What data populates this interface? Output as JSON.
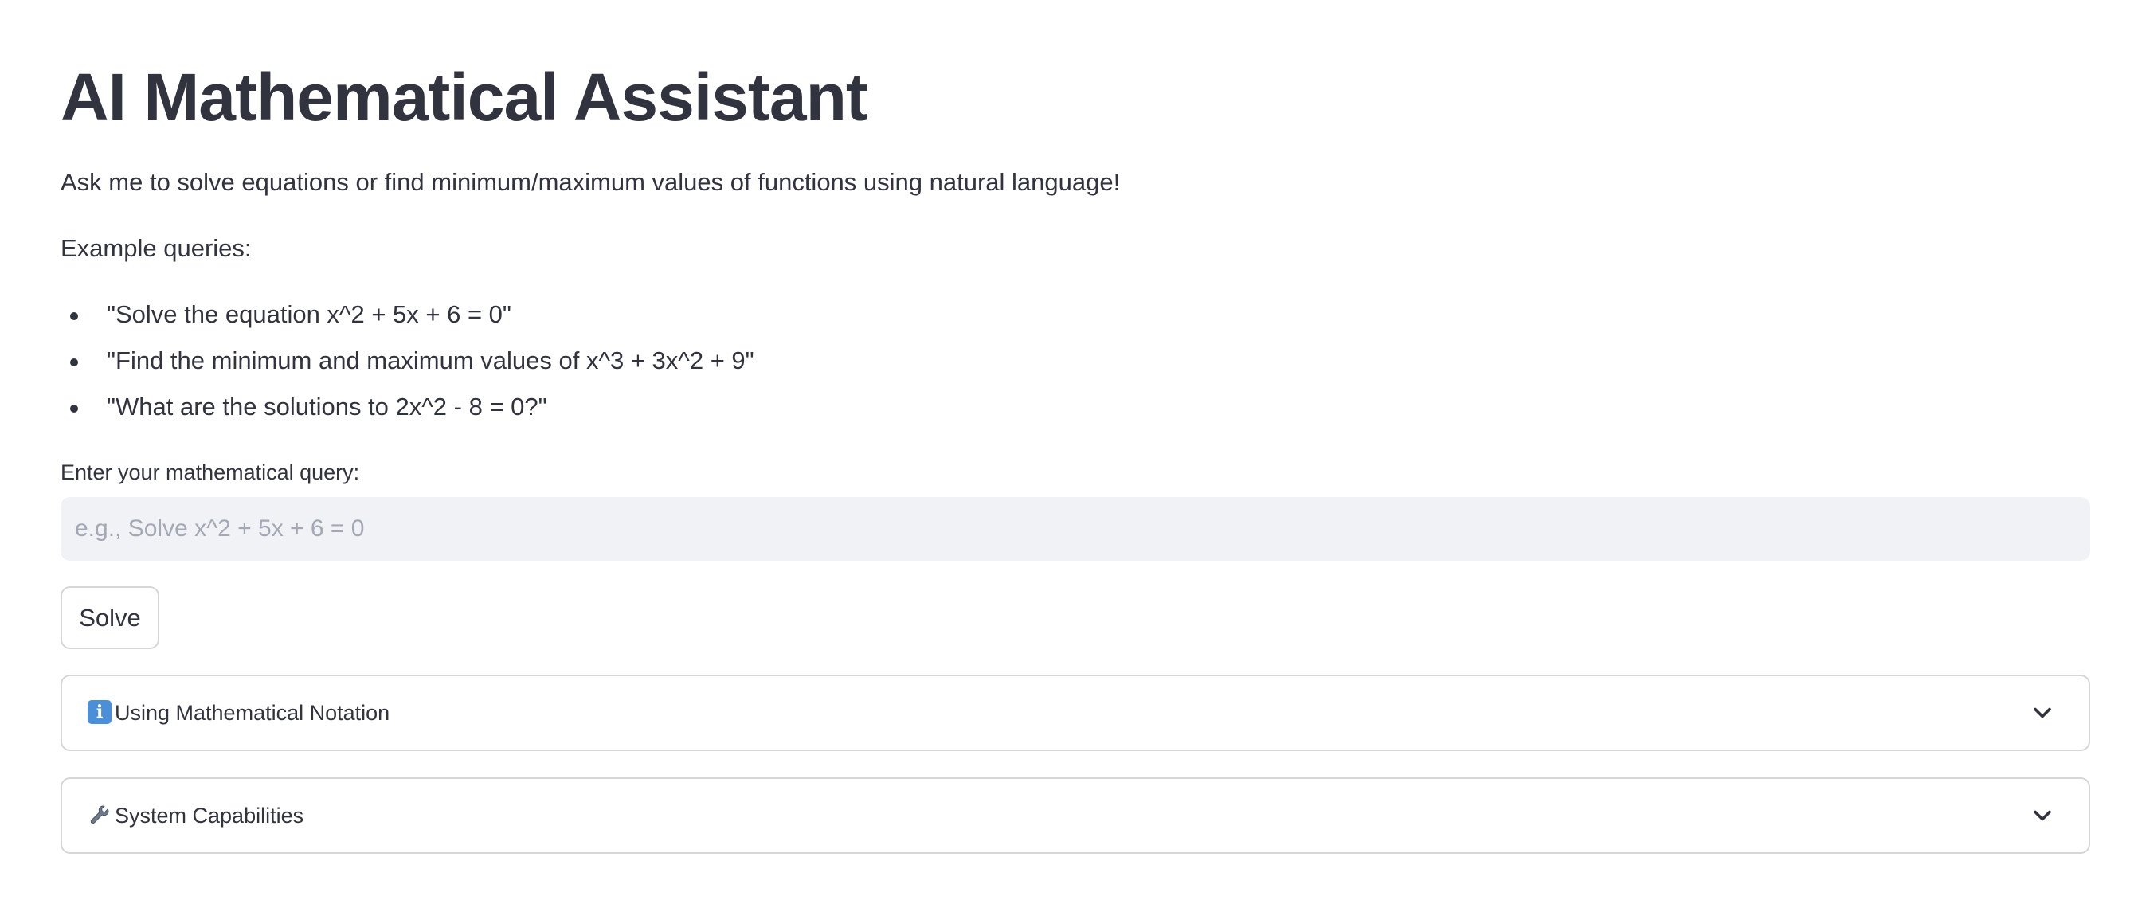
{
  "header": {
    "title": "AI Mathematical Assistant"
  },
  "intro": {
    "text": "Ask me to solve equations or find minimum/maximum values of functions using natural language!",
    "examples_label": "Example queries:",
    "examples": [
      "\"Solve the equation x^2 + 5x + 6 = 0\"",
      "\"Find the minimum and maximum values of x^3 + 3x^2 + 9\"",
      "\"What are the solutions to 2x^2 - 8 = 0?\""
    ]
  },
  "query": {
    "label": "Enter your mathematical query:",
    "placeholder": "e.g., Solve x^2 + 5x + 6 = 0",
    "value": ""
  },
  "solve_button": {
    "label": "Solve"
  },
  "expanders": [
    {
      "icon": "info-icon",
      "label": "Using Mathematical Notation",
      "expanded": false
    },
    {
      "icon": "wrench-icon",
      "label": "System Capabilities",
      "expanded": false
    }
  ],
  "colors": {
    "text": "#31333f",
    "input_bg": "#f0f2f6",
    "placeholder": "#a3a8b4",
    "border": "#d6d6d9",
    "info_icon": "#4a8fd8"
  }
}
